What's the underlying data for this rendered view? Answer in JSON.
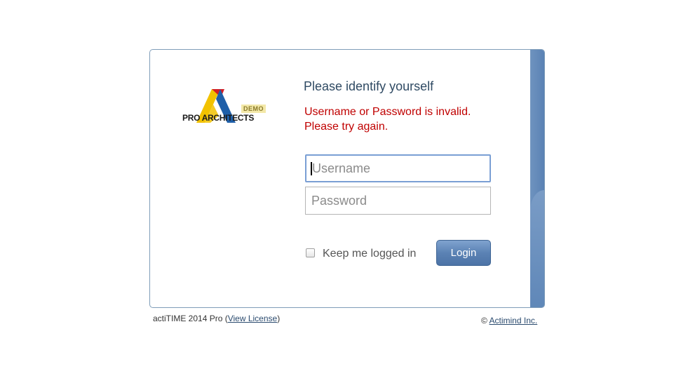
{
  "login": {
    "heading": "Please identify yourself",
    "error_line1": "Username or Password is invalid.",
    "error_line2": "Please try again.",
    "username_placeholder": "Username",
    "password_placeholder": "Password",
    "remember_label": "Keep me logged in",
    "remember_checked": false,
    "login_button": "Login"
  },
  "logo": {
    "name": "PRO ARCHITECTS",
    "badge": "DEMO",
    "icon": "pro-architects-logo-icon"
  },
  "footer": {
    "product": "actiTIME 2014 Pro",
    "license_open": "(",
    "license_link": "View License",
    "license_close": ")",
    "copyright_symbol": "©",
    "company_link": "Actimind Inc."
  },
  "colors": {
    "heading": "#2f4a63",
    "error": "#c00000",
    "accent": "#5b82b4"
  }
}
